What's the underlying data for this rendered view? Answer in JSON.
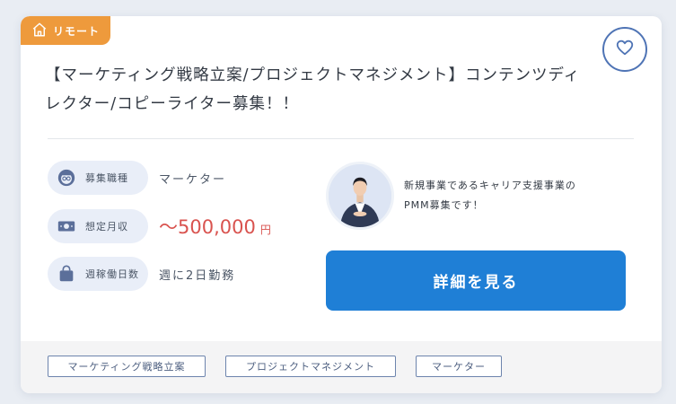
{
  "badge": {
    "label": "リモート",
    "icon": "home-icon",
    "color": "#ee9a3c"
  },
  "favorite": {
    "icon": "heart-icon"
  },
  "title": "【マーケティング戦略立案/プロジェクトマネジメント】コンテンツディレクター/コピーライター募集！！",
  "info": {
    "job_type": {
      "label": "募集職種",
      "value": "マーケター",
      "icon": "person-glasses-icon"
    },
    "salary": {
      "label": "想定月収",
      "value": "〜500,000",
      "unit": "円",
      "icon": "money-icon"
    },
    "workdays": {
      "label": "週稼働日数",
      "value": "週に2日勤務",
      "icon": "bag-icon"
    }
  },
  "recruiter": {
    "message_line1": "新規事業であるキャリア支援事業の",
    "message_line2": "PMM募集です！"
  },
  "detail_button": {
    "label": "詳細を見る",
    "color": "#1f7fd6"
  },
  "tags": [
    "マーケティング戦略立案",
    "プロジェクトマネジメント",
    "マーケター"
  ],
  "colors": {
    "salary": "#d9534f",
    "accent": "#4f74b5"
  }
}
